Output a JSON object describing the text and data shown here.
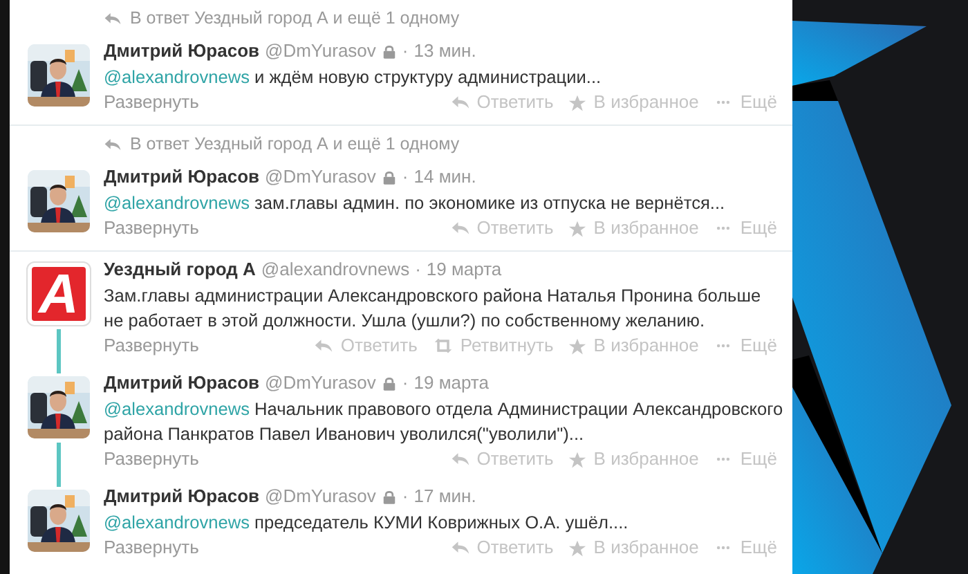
{
  "threads": [
    {
      "kind": "reply",
      "context": "В ответ Уездный город А и ещё 1 одному",
      "tweets": [
        {
          "avatar": {
            "kind": "picture"
          },
          "name": "Дмитрий Юрасов",
          "handle": "@DmYurasov",
          "protected": true,
          "separator": "·",
          "time": "13 мин.",
          "mention": "@alexandrovnews",
          "text": "и ждём новую структуру администрации...",
          "expand": "Развернуть",
          "actions": [
            {
              "kind": "reply",
              "label": "Ответить"
            },
            {
              "kind": "favorite",
              "label": "В избранное"
            },
            {
              "kind": "more",
              "label": "Ещё"
            }
          ]
        }
      ]
    },
    {
      "kind": "reply",
      "context": "В ответ Уездный город А и ещё 1 одному",
      "tweets": [
        {
          "avatar": {
            "kind": "picture"
          },
          "name": "Дмитрий Юрасов",
          "handle": "@DmYurasov",
          "protected": true,
          "separator": "·",
          "time": "14 мин.",
          "mention": "@alexandrovnews",
          "text": "зам.главы админ. по экономике из отпуска не вернётся...",
          "expand": "Развернуть",
          "actions": [
            {
              "kind": "reply",
              "label": "Ответить"
            },
            {
              "kind": "favorite",
              "label": "В избранное"
            },
            {
              "kind": "more",
              "label": "Ещё"
            }
          ]
        }
      ]
    },
    {
      "kind": "conversation",
      "tweets": [
        {
          "avatar": {
            "kind": "logo",
            "text": "А"
          },
          "name": "Уездный город А",
          "handle": "@alexandrovnews",
          "protected": false,
          "separator": "·",
          "time": "19 марта",
          "text": "Зам.главы администрации Александровского района Наталья Пронина больше не работает в этой должности. Ушла (ушли?) по собственному желанию.",
          "expand": "Развернуть",
          "actions": [
            {
              "kind": "reply",
              "label": "Ответить"
            },
            {
              "kind": "retweet",
              "label": "Ретвитнуть"
            },
            {
              "kind": "favorite",
              "label": "В избранное"
            },
            {
              "kind": "more",
              "label": "Ещё"
            }
          ]
        },
        {
          "avatar": {
            "kind": "picture"
          },
          "name": "Дмитрий Юрасов",
          "handle": "@DmYurasov",
          "protected": true,
          "separator": "·",
          "time": "19 марта",
          "mention": "@alexandrovnews",
          "text": "Начальник правового отдела Администрации Александровского района Панкратов Павел Иванович уволился(\"уволили\")...",
          "expand": "Развернуть",
          "actions": [
            {
              "kind": "reply",
              "label": "Ответить"
            },
            {
              "kind": "favorite",
              "label": "В избранное"
            },
            {
              "kind": "more",
              "label": "Ещё"
            }
          ]
        },
        {
          "avatar": {
            "kind": "picture"
          },
          "name": "Дмитрий Юрасов",
          "handle": "@DmYurasov",
          "protected": true,
          "separator": "·",
          "time": "17 мин.",
          "mention": "@alexandrovnews",
          "text": "председатель КУМИ Коврижных О.А. ушёл....",
          "expand": "Развернуть",
          "actions": [
            {
              "kind": "reply",
              "label": "Ответить"
            },
            {
              "kind": "favorite",
              "label": "В избранное"
            },
            {
              "kind": "more",
              "label": "Ещё"
            }
          ]
        }
      ]
    }
  ]
}
